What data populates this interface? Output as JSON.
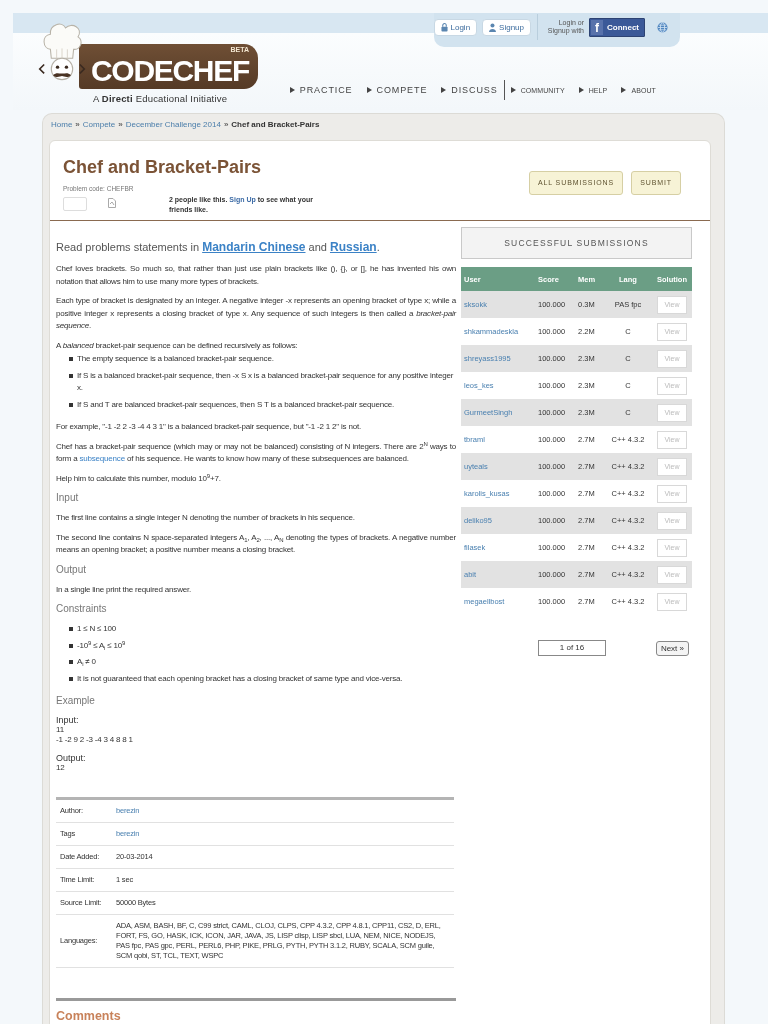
{
  "logo": {
    "name": "CODECHEF",
    "badge": "BETA",
    "tagline": "A **Directi** Educational Initiative"
  },
  "account": {
    "login": "Login",
    "signup": "Signup",
    "social_prompt": "Login or Signup with",
    "facebook_mark": "f",
    "facebook": "Connect"
  },
  "nav": [
    {
      "label": "PRACTICE",
      "kind": "main"
    },
    {
      "label": "COMPETE",
      "kind": "main"
    },
    {
      "label": "DISCUSS",
      "kind": "main"
    },
    {
      "label": "COMMUNITY",
      "kind": "minor"
    },
    {
      "label": "HELP",
      "kind": "minor"
    },
    {
      "label": "ABOUT",
      "kind": "minor"
    }
  ],
  "breadcrumb": [
    {
      "text": "Home",
      "kind": "link"
    },
    {
      "text": "»",
      "kind": "separator"
    },
    {
      "text": "Compete",
      "kind": "link"
    },
    {
      "text": "»",
      "kind": "separator"
    },
    {
      "text": "December Challenge 2014",
      "kind": "link"
    },
    {
      "text": "»",
      "kind": "separator"
    },
    {
      "text": "Chef and Bracket-Pairs",
      "kind": "current"
    }
  ],
  "problem": {
    "title": "Chef and Bracket-Pairs",
    "code": "Problem code: CHEFBR",
    "likes": [
      {
        "kind": "text",
        "text": "2 people like this. "
      },
      {
        "kind": "link",
        "text": "Sign Up"
      },
      {
        "kind": "text",
        "text": " to see what your friends like."
      }
    ],
    "buttons": [
      "ALL SUBMISSIONS",
      "SUBMIT"
    ]
  },
  "statement": [
    {
      "kind": "intro",
      "parts": [
        {
          "kind": "text",
          "text": "Read problems statements in "
        },
        {
          "kind": "link",
          "text": "Mandarin Chinese"
        },
        {
          "kind": "text",
          "text": " and "
        },
        {
          "kind": "link",
          "text": "Russian"
        },
        {
          "kind": "text",
          "text": "."
        }
      ]
    },
    {
      "kind": "paragraph",
      "text": "Chef loves brackets. So much so, that rather than just use plain brackets like (), {}, or [], he has invented his own notation that allows him to use many more types of brackets."
    },
    {
      "kind": "paragraph",
      "text": "Each type of bracket is designated by an integer. A negative integer -x represents an opening bracket of type x; while a positive integer x represents a closing bracket of type x. Any sequence of such integers is then called a *bracket-pair sequence*."
    },
    {
      "kind": "lead",
      "text": "A *balanced* bracket-pair sequence can be defined recursively as follows:"
    },
    {
      "kind": "list",
      "items": [
        "The empty sequence is a balanced bracket-pair sequence.",
        "If S is a balanced bracket-pair sequence, then -x S x is a balanced bracket-pair sequence for any positive integer x.",
        "If S and T are balanced bracket-pair sequences, then S T is a balanced bracket-pair sequence."
      ]
    },
    {
      "kind": "paragraph",
      "text": "For example, \"-1 -2 2 -3 -4 4 3 1\" is a balanced bracket-pair sequence, but \"-1 -2 1 2\" is not."
    },
    {
      "kind": "paragraph",
      "parts": [
        {
          "kind": "text",
          "text": "Chef has a bracket-pair sequence (which may or may not be balanced) consisting of N integers. There are 2$^{N}$ ways to form a "
        },
        {
          "kind": "link",
          "text": "subsequence"
        },
        {
          "kind": "text",
          "text": " of his sequence. He wants to know how many of these subsequences are balanced."
        }
      ]
    },
    {
      "kind": "paragraph",
      "text": "Help him to calculate this number, modulo 10$^{9}$+7."
    },
    {
      "kind": "heading",
      "text": "Input"
    },
    {
      "kind": "paragraph",
      "text": "The first line contains a single integer N denoting the number of brackets in his sequence."
    },
    {
      "kind": "paragraph",
      "text": "The second line contains N space-separated integers A$_{1}$, A$_{2}$, ..., A$_{N}$ denoting the types of brackets. A negative number means an opening bracket; a positive number means a closing bracket."
    },
    {
      "kind": "heading",
      "text": "Output"
    },
    {
      "kind": "paragraph",
      "text": "In a single line print the required answer."
    },
    {
      "kind": "heading",
      "text": "Constraints"
    },
    {
      "kind": "list",
      "items": [
        "1 ≤ N ≤ 100",
        "-10$^{9}$ ≤ A$_{i}$ ≤ 10$^{9}$",
        "A$_{i}$ ≠ 0",
        "It is not guaranteed that each opening bracket has a closing bracket of same type and vice-versa."
      ]
    },
    {
      "kind": "heading",
      "text": "Example"
    },
    {
      "kind": "example",
      "label": "Input:",
      "lines": [
        "11",
        "-1 -2 9 2 -3 -4 3 4 8 8 1"
      ]
    },
    {
      "kind": "example",
      "label": "Output:",
      "lines": [
        "12"
      ]
    }
  ],
  "details": [
    {
      "label": "Author:",
      "value": "berezin",
      "kind": "link"
    },
    {
      "label": "Tags",
      "value": "berezin",
      "kind": "link"
    },
    {
      "label": "Date Added:",
      "value": "20-03-2014",
      "kind": "text"
    },
    {
      "label": "Time Limit:",
      "value": "1 sec",
      "kind": "text"
    },
    {
      "label": "Source Limit:",
      "value": "50000 Bytes",
      "kind": "text"
    },
    {
      "label": "Languages:",
      "value": "ADA, ASM, BASH, BF, C, C99 strict, CAML, CLOJ, CLPS, CPP 4.3.2, CPP 4.8.1, CPP11, CS2, D, ERL, FORT, FS, GO, HASK, ICK, ICON, JAR, JAVA, JS, LISP clisp, LISP sbcl, LUA, NEM, NICE, NODEJS, PAS fpc, PAS gpc, PERL, PERL6, PHP, PIKE, PRLG, PYTH, PYTH 3.1.2, RUBY, SCALA, SCM guile, SCM qobi, ST, TCL, TEXT, WSPC",
      "kind": "text"
    }
  ],
  "comments": {
    "title": "Comments"
  },
  "submissions": {
    "title": "SUCCESSFUL SUBMISSIONS",
    "columns": [
      "User",
      "Score",
      "Mem",
      "Lang",
      "Solution"
    ],
    "rows": [
      {
        "user": "sksokk",
        "score": "100.000",
        "mem": "0.3M",
        "lang": "PAS fpc",
        "action": "View"
      },
      {
        "user": "shkammadeskla",
        "score": "100.000",
        "mem": "2.2M",
        "lang": "C",
        "action": "View"
      },
      {
        "user": "shreyass1995",
        "score": "100.000",
        "mem": "2.3M",
        "lang": "C",
        "action": "View"
      },
      {
        "user": "leos_kes",
        "score": "100.000",
        "mem": "2.3M",
        "lang": "C",
        "action": "View"
      },
      {
        "user": "GurmeetSingh",
        "score": "100.000",
        "mem": "2.3M",
        "lang": "C",
        "action": "View"
      },
      {
        "user": "tbraml",
        "score": "100.000",
        "mem": "2.7M",
        "lang": "C++ 4.3.2",
        "action": "View"
      },
      {
        "user": "uyteals",
        "score": "100.000",
        "mem": "2.7M",
        "lang": "C++ 4.3.2",
        "action": "View"
      },
      {
        "user": "karolis_kusas",
        "score": "100.000",
        "mem": "2.7M",
        "lang": "C++ 4.3.2",
        "action": "View"
      },
      {
        "user": "deliko95",
        "score": "100.000",
        "mem": "2.7M",
        "lang": "C++ 4.3.2",
        "action": "View"
      },
      {
        "user": "filasek",
        "score": "100.000",
        "mem": "2.7M",
        "lang": "C++ 4.3.2",
        "action": "View"
      },
      {
        "user": "abit",
        "score": "100.000",
        "mem": "2.7M",
        "lang": "C++ 4.3.2",
        "action": "View"
      },
      {
        "user": "megaellbost",
        "score": "100.000",
        "mem": "2.7M",
        "lang": "C++ 4.3.2",
        "action": "View"
      }
    ],
    "pager": {
      "page": "1 of 16",
      "next": "Next »"
    }
  }
}
